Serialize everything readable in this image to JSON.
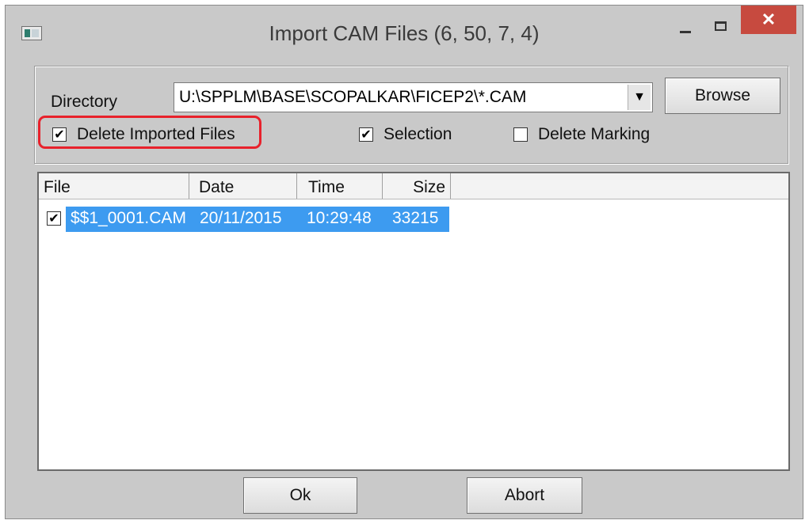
{
  "window": {
    "title": "Import CAM Files (6, 50, 7, 4)",
    "icons": {
      "app": "app-icon",
      "minimize": "minimize-icon",
      "maximize": "maximize-icon",
      "close": "close-icon"
    },
    "close_glyph": "✕"
  },
  "options": {
    "directory_label": "Directory",
    "directory_value": "U:\\SPPLM\\BASE\\SCOPALKAR\\FICEP2\\*.CAM",
    "dropdown_glyph": "▼",
    "browse_label": "Browse",
    "delete_imported": {
      "label": "Delete Imported Files",
      "checked": true
    },
    "selection": {
      "label": "Selection",
      "checked": true
    },
    "delete_marking": {
      "label": "Delete Marking",
      "checked": false
    },
    "highlight_color": "#e8212b"
  },
  "file_list": {
    "columns": [
      "File",
      "Date",
      "Time",
      "Size"
    ],
    "rows": [
      {
        "checked": true,
        "file": "$$1_0001.CAM",
        "date": "20/11/2015",
        "time": "10:29:48",
        "size": "33215",
        "selected": true
      }
    ],
    "selection_color": "#3d9bf0"
  },
  "buttons": {
    "ok": "Ok",
    "abort": "Abort"
  },
  "check_glyph": "✔"
}
